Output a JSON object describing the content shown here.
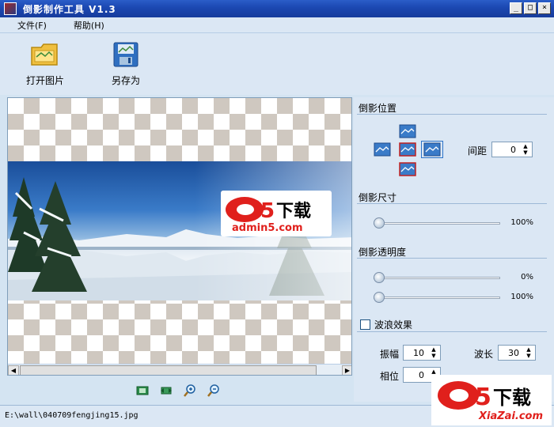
{
  "window": {
    "title": "倒影制作工具 V1.3",
    "controls": [
      "_",
      "□",
      "×"
    ]
  },
  "menu": {
    "file": "文件(F)",
    "help": "帮助(H)"
  },
  "toolbar": {
    "open_label": "打开图片",
    "save_as_label": "另存为"
  },
  "canvas": {
    "watermark_logo_text": "a5下载",
    "watermark_url": "admin5.com"
  },
  "panel": {
    "position_title": "倒影位置",
    "spacing_label": "间距",
    "spacing_value": "0",
    "size_title": "倒影尺寸",
    "size_value": "100%",
    "opacity_title": "倒影透明度",
    "opacity_start_value": "0%",
    "opacity_end_value": "100%",
    "wave_label": "波浪效果",
    "wave_checked": false,
    "amplitude_label": "振幅",
    "amplitude_value": "10",
    "wavelength_label": "波长",
    "wavelength_value": "30",
    "phase_label": "相位",
    "phase_value": "0"
  },
  "status": {
    "file_path": "E:\\wall\\040709fengjing15.jpg"
  },
  "brand": {
    "logo_text": "a5下载",
    "url": "XiaZai.com"
  },
  "colors": {
    "titlebar": "#1c49b3",
    "panel_bg": "#dbe7f4",
    "checker_gray": "#cfc8c0",
    "logo_red": "#e0201c"
  }
}
